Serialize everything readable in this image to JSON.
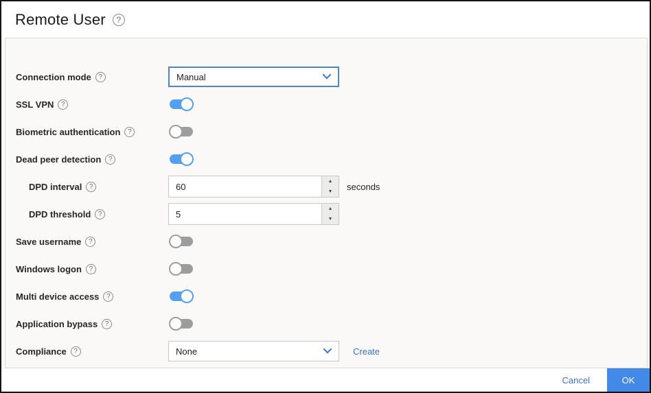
{
  "dialog": {
    "title": "Remote User"
  },
  "icons": {
    "help": "?",
    "arrow_up": "▲",
    "arrow_down": "▼"
  },
  "form": {
    "connection_mode": {
      "label": "Connection mode",
      "value": "Manual"
    },
    "ssl_vpn": {
      "label": "SSL VPN",
      "state": "on"
    },
    "biometric_authentication": {
      "label": "Biometric authentication",
      "state": "off"
    },
    "dead_peer_detection": {
      "label": "Dead peer detection",
      "state": "on"
    },
    "dpd_interval": {
      "label": "DPD interval",
      "value": "60",
      "suffix": "seconds"
    },
    "dpd_threshold": {
      "label": "DPD threshold",
      "value": "5"
    },
    "save_username": {
      "label": "Save username",
      "state": "off"
    },
    "windows_logon": {
      "label": "Windows logon",
      "state": "off"
    },
    "multi_device_access": {
      "label": "Multi device access",
      "state": "on"
    },
    "application_bypass": {
      "label": "Application bypass",
      "state": "off"
    },
    "compliance": {
      "label": "Compliance",
      "value": "None",
      "create_label": "Create"
    }
  },
  "footer": {
    "cancel_label": "Cancel",
    "ok_label": "OK"
  },
  "colors": {
    "accent_border_blue": "#4c86c6",
    "chevron_blue": "#3b78d8",
    "toggle_on_blue": "#55a0ee",
    "toggle_off_gray": "#9d9d9d",
    "link_blue": "#3a6fd8",
    "ok_button_blue": "#4289e8"
  }
}
